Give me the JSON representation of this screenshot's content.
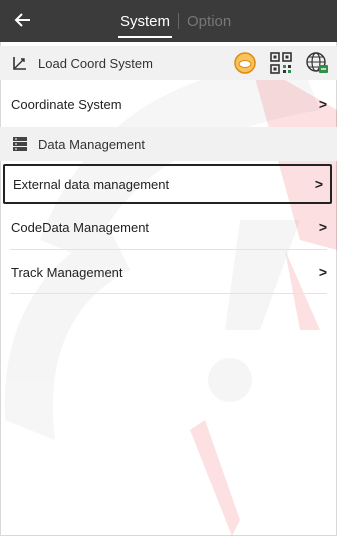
{
  "header": {
    "back_icon": "back-arrow-icon",
    "tabs": [
      {
        "label": "System",
        "active": true
      },
      {
        "label": "Option",
        "active": false
      }
    ]
  },
  "coord_section": {
    "title": "Load Coord System",
    "icons": [
      "coordinate-axes-icon",
      "badge-icon",
      "qr-code-icon",
      "globe-icon"
    ]
  },
  "rows_top": [
    {
      "label": "Coordinate System",
      "chevron": ">"
    }
  ],
  "data_section": {
    "title": "Data Management",
    "icon": "database-icon"
  },
  "rows_data": [
    {
      "label": "External data management",
      "chevron": ">",
      "selected": true
    },
    {
      "label": "CodeData Management",
      "chevron": ">",
      "selected": false
    },
    {
      "label": "Track Management",
      "chevron": ">",
      "selected": false
    }
  ],
  "colors": {
    "topbar": "#3b3b3b",
    "section_bg": "#f1f1f1",
    "badge_orange": "#f0a020",
    "globe_green": "#2f8f4a",
    "watermark_red": "#e60012"
  }
}
